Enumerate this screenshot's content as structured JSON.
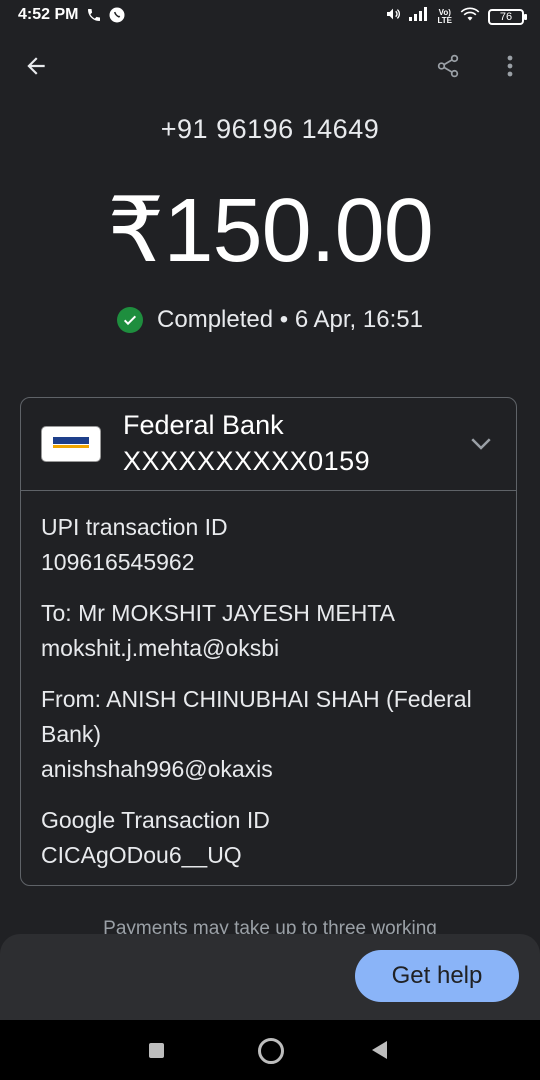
{
  "status_bar": {
    "time": "4:52 PM",
    "battery": "76",
    "network_label_top": "Vo)",
    "network_label_bottom": "LTE",
    "icons": [
      "phone-icon",
      "whatsapp-icon",
      "volume-icon",
      "signal-icon",
      "wifi-icon",
      "battery-icon"
    ]
  },
  "header": {
    "icons": [
      "back-arrow-icon",
      "share-icon",
      "more-vert-icon"
    ]
  },
  "payment": {
    "recipient_phone": "+91 96196 14649",
    "amount": "₹150.00",
    "status": "Completed • 6 Apr, 16:51"
  },
  "bank": {
    "name": "Federal Bank",
    "account": "XXXXXXXXXX0159"
  },
  "details": {
    "upi_label": "UPI transaction ID",
    "upi_id": "109616545962",
    "to_label": "To: Mr MOKSHIT JAYESH MEHTA",
    "to_upi": "mokshit.j.mehta@oksbi",
    "from_label": "From: ANISH CHINUBHAI SHAH (Federal Bank)",
    "from_upi": "anishshah996@okaxis",
    "google_label": "Google Transaction ID",
    "google_id": "CICAgODou6__UQ"
  },
  "footer": {
    "note": "Payments may take up to three working",
    "help_button": "Get help"
  },
  "colors": {
    "background": "#202124",
    "success": "#1e8e3e",
    "button": "#8ab4f8"
  }
}
